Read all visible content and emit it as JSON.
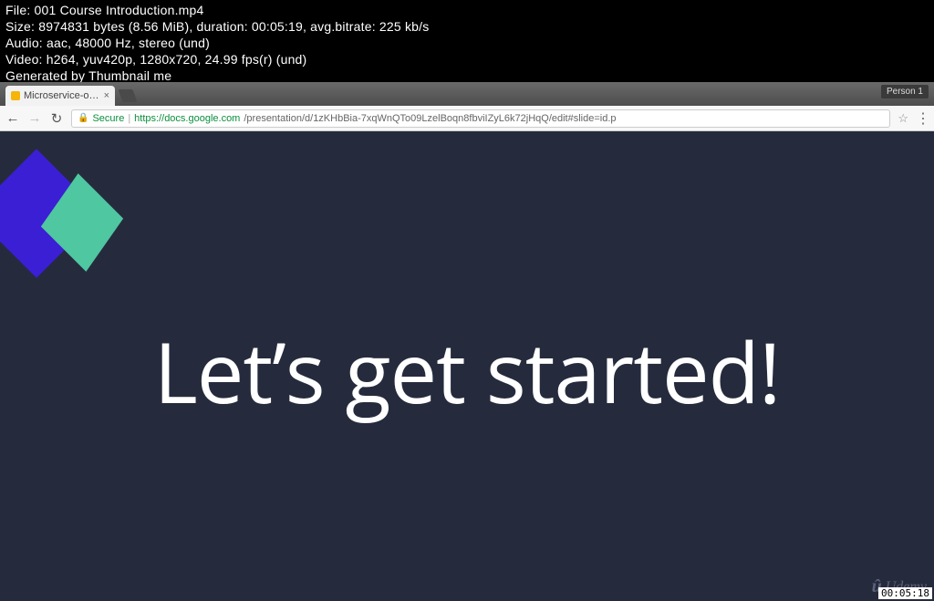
{
  "meta": {
    "file_line": "File: 001 Course Introduction.mp4",
    "size_line": "Size: 8974831 bytes (8.56 MiB), duration: 00:05:19, avg.bitrate: 225 kb/s",
    "audio_line": "Audio: aac, 48000 Hz, stereo (und)",
    "video_line": "Video: h264, yuv420p, 1280x720, 24.99 fps(r) (und)",
    "generated_line": "Generated by Thumbnail me"
  },
  "browser": {
    "tab_title": "Microservice-over…",
    "person_label": "Person 1",
    "nav": {
      "secure_label": "Secure",
      "url_host": "https://docs.google.com",
      "url_rest": "/presentation/d/1zKHbBia-7xqWnQTo09LzelBoqn8fbviIZyL6k72jHqQ/edit#slide=id.p"
    }
  },
  "slide": {
    "headline": "Let’s get started!",
    "watermark": "Udemy"
  },
  "timestamp": "00:05:18"
}
